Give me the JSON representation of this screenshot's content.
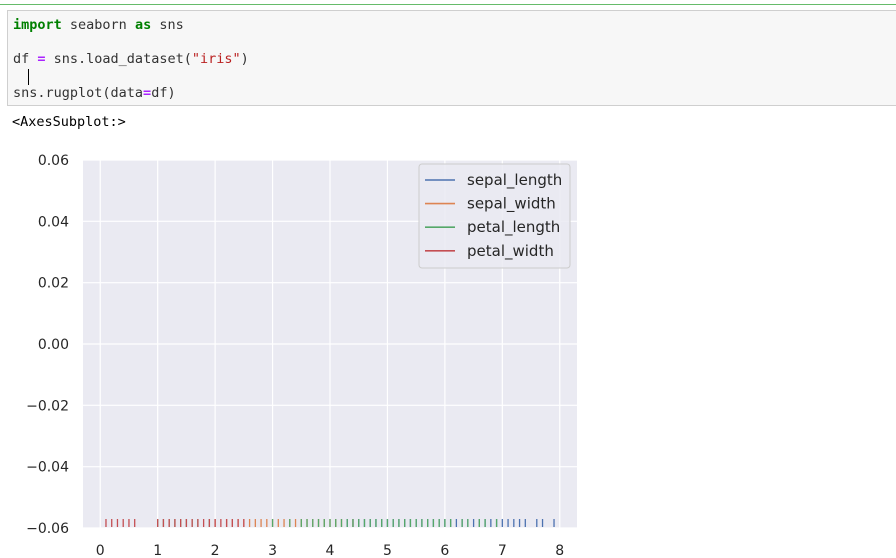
{
  "code": {
    "line1": {
      "kw1": "import",
      "mid": " seaborn ",
      "kw2": "as",
      "end": " sns"
    },
    "line2": {
      "pre": "df ",
      "op": "=",
      "mid": " sns.load_dataset(",
      "str": "\"iris\"",
      "end": ")"
    },
    "line3": {
      "pre": "sns.rugplot(data",
      "op": "=",
      "end": "df)"
    }
  },
  "output": {
    "repr": "<AxesSubplot:>"
  },
  "chart_data": {
    "type": "rugplot",
    "xlim": [
      -0.3,
      8.3
    ],
    "ylim": [
      -0.06,
      0.06
    ],
    "yticks": [
      "0.06",
      "0.04",
      "0.02",
      "0.00",
      "−0.02",
      "−0.04",
      "−0.06"
    ],
    "ytick_values": [
      0.06,
      0.04,
      0.02,
      0.0,
      -0.02,
      -0.04,
      -0.06
    ],
    "xticks": [
      "0",
      "1",
      "2",
      "3",
      "4",
      "5",
      "6",
      "7",
      "8"
    ],
    "xtick_values": [
      0,
      1,
      2,
      3,
      4,
      5,
      6,
      7,
      8
    ],
    "grid": true,
    "legend_position": "top-right",
    "series": [
      {
        "name": "sepal_length",
        "color": "#4c72b0",
        "values": [
          4.3,
          4.4,
          4.5,
          4.6,
          4.7,
          4.8,
          4.9,
          5.0,
          5.1,
          5.2,
          5.3,
          5.4,
          5.5,
          5.6,
          5.7,
          5.8,
          5.9,
          6.0,
          6.1,
          6.2,
          6.3,
          6.4,
          6.5,
          6.6,
          6.7,
          6.8,
          6.9,
          7.0,
          7.1,
          7.2,
          7.3,
          7.4,
          7.6,
          7.7,
          7.9
        ]
      },
      {
        "name": "sepal_width",
        "color": "#dd8452",
        "values": [
          2.0,
          2.2,
          2.3,
          2.4,
          2.5,
          2.6,
          2.7,
          2.8,
          2.9,
          3.0,
          3.1,
          3.2,
          3.3,
          3.4,
          3.5,
          3.6,
          3.7,
          3.8,
          3.9,
          4.0,
          4.1,
          4.2,
          4.4
        ]
      },
      {
        "name": "petal_length",
        "color": "#55a868",
        "values": [
          1.0,
          1.1,
          1.2,
          1.3,
          1.4,
          1.5,
          1.6,
          1.7,
          1.9,
          3.0,
          3.3,
          3.5,
          3.6,
          3.7,
          3.8,
          3.9,
          4.0,
          4.1,
          4.2,
          4.3,
          4.4,
          4.5,
          4.6,
          4.7,
          4.8,
          4.9,
          5.0,
          5.1,
          5.2,
          5.3,
          5.4,
          5.5,
          5.6,
          5.7,
          5.8,
          5.9,
          6.0,
          6.1,
          6.3,
          6.4,
          6.6,
          6.7,
          6.9
        ]
      },
      {
        "name": "petal_width",
        "color": "#c44e52",
        "values": [
          0.1,
          0.2,
          0.3,
          0.4,
          0.5,
          0.6,
          1.0,
          1.1,
          1.2,
          1.3,
          1.4,
          1.5,
          1.6,
          1.7,
          1.8,
          1.9,
          2.0,
          2.1,
          2.2,
          2.3,
          2.4,
          2.5
        ]
      }
    ]
  }
}
